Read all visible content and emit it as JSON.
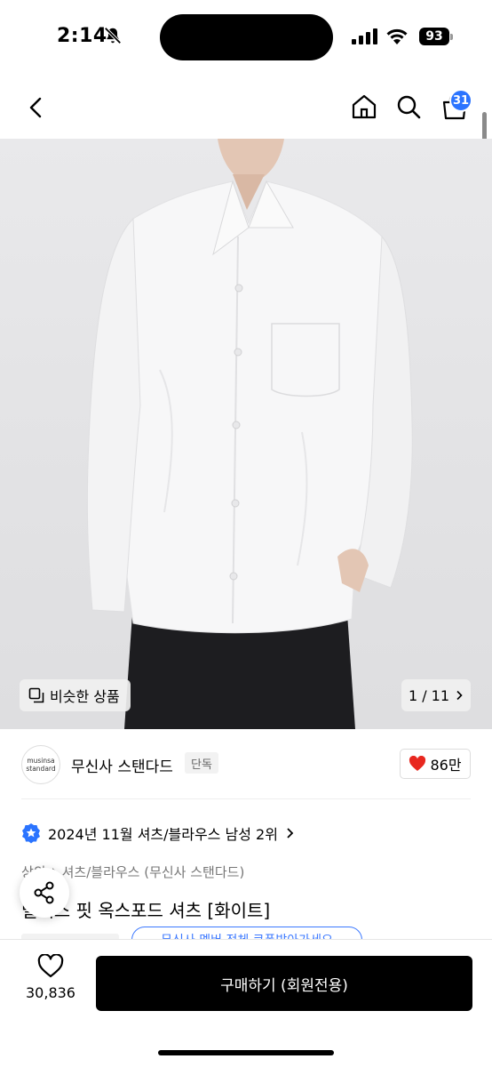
{
  "status_bar": {
    "time": "2:14",
    "battery": "93"
  },
  "header": {
    "cart_count": "31",
    "icons": [
      "back-icon",
      "home-icon",
      "search-icon",
      "cart-icon"
    ]
  },
  "gallery": {
    "similar_label": "비슷한 상품",
    "page_indicator": "1 / 11"
  },
  "brand": {
    "logo_line1": "musinsa",
    "logo_line2": "standard",
    "name": "무신사 스탠다드",
    "tag": "단독",
    "likes": "86만"
  },
  "ranking": {
    "text": "2024년 11월 셔츠/블라우스 남성 2위"
  },
  "breadcrumb": {
    "level1": "상의",
    "level2": "셔츠/블라우스 (무신사 스탠다드)"
  },
  "product": {
    "title": "릴렉스 핏 옥스포드 셔츠 [화이트]"
  },
  "coupon": {
    "text": "무신사 멤버 전체 쿠폰받아가세요"
  },
  "bottom_bar": {
    "wish_count": "30,836",
    "buy_label": "구매하기 (회원전용)"
  },
  "colors": {
    "accent_blue": "#2b74ff",
    "like_red": "#e8271f",
    "button_black": "#000000"
  }
}
